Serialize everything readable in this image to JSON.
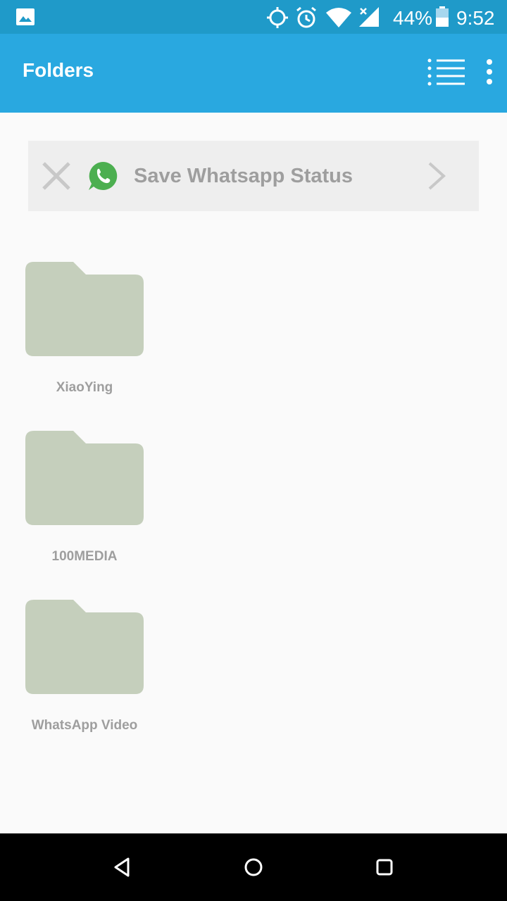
{
  "status_bar": {
    "battery_percent": "44%",
    "time": "9:52",
    "icons": [
      "gallery-icon",
      "gps-icon",
      "alarm-icon",
      "wifi-icon",
      "signal-icon",
      "battery-icon"
    ]
  },
  "app_bar": {
    "title": "Folders",
    "icons": [
      "list-view-icon",
      "more-vert-icon"
    ]
  },
  "banner": {
    "label": "Save Whatsapp Status",
    "icons": [
      "close-icon",
      "whatsapp-icon",
      "chevron-right-icon"
    ]
  },
  "folders": [
    {
      "name": "XiaoYing"
    },
    {
      "name": "100MEDIA"
    },
    {
      "name": "WhatsApp Video"
    }
  ],
  "nav_bar": {
    "icons": [
      "back-icon",
      "home-icon",
      "recent-apps-icon"
    ]
  },
  "colors": {
    "status_bar": "#1f9ac9",
    "app_bar": "#29a8e0",
    "folder": "#c5cfbc",
    "whatsapp": "#4caf50",
    "banner_bg": "#eeeeee"
  }
}
